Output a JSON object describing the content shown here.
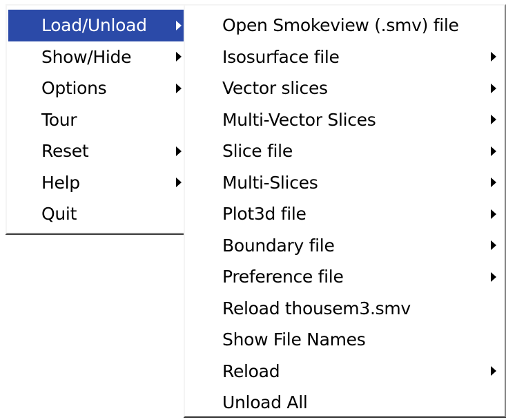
{
  "main_menu": {
    "items": [
      {
        "label": "Load/Unload",
        "submenu": true,
        "highlighted": true
      },
      {
        "label": "Show/Hide",
        "submenu": true
      },
      {
        "label": "Options",
        "submenu": true
      },
      {
        "label": "Tour",
        "submenu": false
      },
      {
        "label": "Reset",
        "submenu": true
      },
      {
        "label": "Help",
        "submenu": true
      },
      {
        "label": "Quit",
        "submenu": false
      }
    ]
  },
  "sub_menu": {
    "items": [
      {
        "label": "Open Smokeview (.smv) file",
        "submenu": false
      },
      {
        "label": "Isosurface file",
        "submenu": true
      },
      {
        "label": "Vector slices",
        "submenu": true
      },
      {
        "label": "Multi-Vector Slices",
        "submenu": true
      },
      {
        "label": "Slice file",
        "submenu": true
      },
      {
        "label": "Multi-Slices",
        "submenu": true
      },
      {
        "label": "Plot3d file",
        "submenu": true
      },
      {
        "label": "Boundary file",
        "submenu": true
      },
      {
        "label": "Preference file",
        "submenu": true
      },
      {
        "label": "Reload thousem3.smv",
        "submenu": false
      },
      {
        "label": "Show File Names",
        "submenu": false
      },
      {
        "label": "Reload",
        "submenu": true
      },
      {
        "label": "Unload All",
        "submenu": false
      }
    ]
  },
  "colors": {
    "highlight": "#2b4aa8",
    "menu_background": "#ffffff"
  }
}
